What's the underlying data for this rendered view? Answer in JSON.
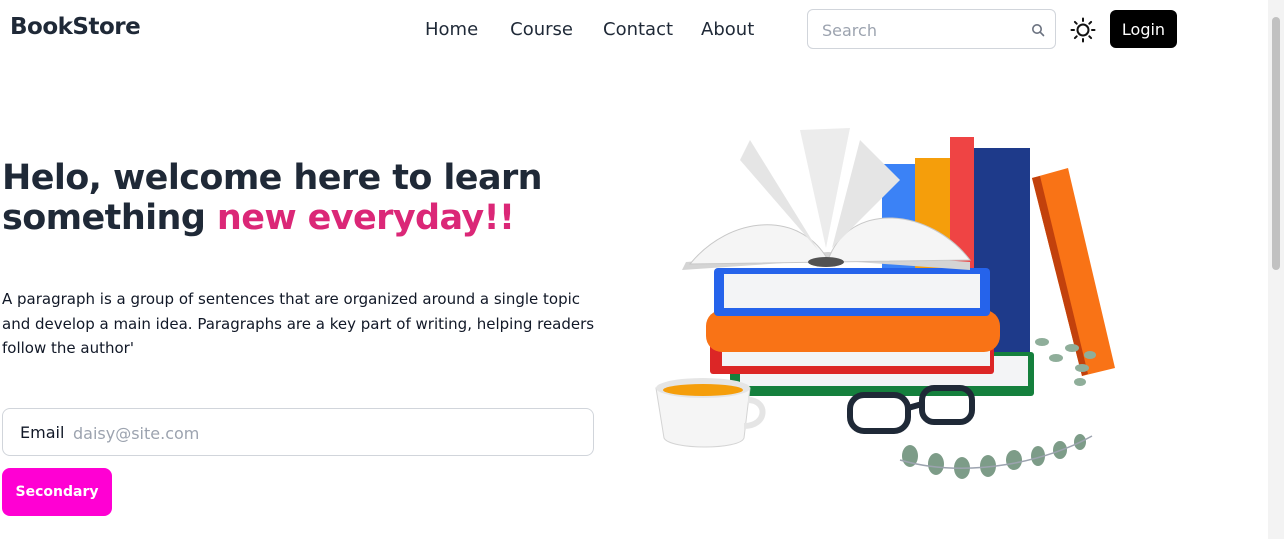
{
  "navbar": {
    "brand": "BookStore",
    "links": [
      "Home",
      "Course",
      "Contact",
      "About"
    ],
    "search_placeholder": "Search",
    "login_label": "Login"
  },
  "hero": {
    "title_main": "Helo, welcome here to learn something ",
    "title_accent": "new everyday!!",
    "paragraph": "A paragraph is a group of sentences that are organized around a single topic and develop a main idea. Paragraphs are a key part of writing, helping readers follow the author'",
    "email_label": "Email",
    "email_placeholder": "daisy@site.com",
    "button_label": "Secondary"
  },
  "icons": {
    "search": "search-icon",
    "theme": "sun-icon",
    "illustration": "books-illustration"
  },
  "colors": {
    "accent": "#db2777",
    "login_bg": "#000000",
    "secondary_bg": "#ff00d3",
    "text": "#1f2937"
  }
}
